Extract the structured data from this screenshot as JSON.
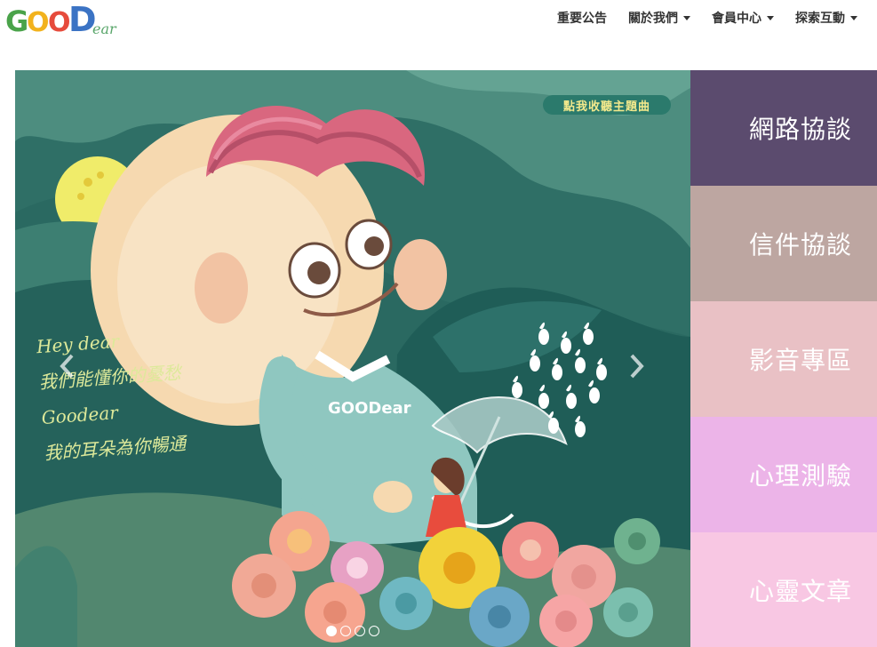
{
  "header": {
    "logo_text": "GOODear",
    "nav": [
      {
        "label": "重要公告",
        "has_dropdown": false
      },
      {
        "label": "關於我們",
        "has_dropdown": true
      },
      {
        "label": "會員中心",
        "has_dropdown": true
      },
      {
        "label": "探索互動",
        "has_dropdown": true
      }
    ]
  },
  "slider": {
    "song_badge": "點我收聽主題曲",
    "handwriting": [
      "Hey dear",
      "我們能懂你的憂愁",
      "Goodear",
      "我的耳朵為你暢通"
    ],
    "shirt_logo": "GOODear",
    "slide_count": 4,
    "active_slide": 1
  },
  "side_menu": [
    {
      "label": "網路協談",
      "color": "#5b4b6e"
    },
    {
      "label": "信件協談",
      "color": "#bda6a1"
    },
    {
      "label": "影音專區",
      "color": "#e9c1c5"
    },
    {
      "label": "心理測驗",
      "color": "#ecb4e8"
    },
    {
      "label": "心靈文章",
      "color": "#f8c7e3"
    }
  ],
  "colors": {
    "slider_bg": "#2f6f66",
    "accent_yellow": "#f3e98c"
  }
}
